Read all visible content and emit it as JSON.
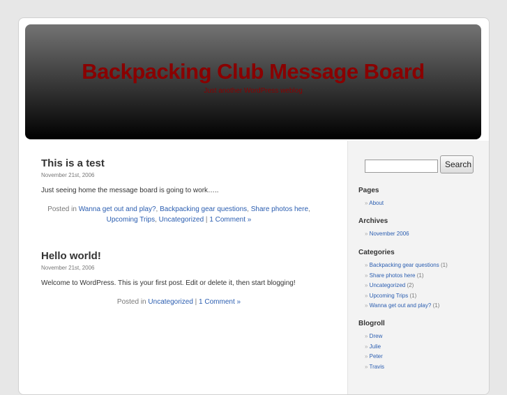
{
  "header": {
    "title": "Backpacking Club Message Board",
    "description": "Just another WordPress weblog"
  },
  "posts": [
    {
      "title": "This is a test",
      "date": "November 21st, 2006",
      "body": "Just seeing home the message board is going to work…..",
      "posted_in": "Posted in",
      "categories": [
        "Wanna get out and play?",
        "Backpacking gear questions",
        "Share photos here",
        "Upcoming Trips",
        "Uncategorized"
      ],
      "comments": "1 Comment »"
    },
    {
      "title": "Hello world!",
      "date": "November 21st, 2006",
      "body": "Welcome to WordPress. This is your first post. Edit or delete it, then start blogging!",
      "posted_in": "Posted in",
      "categories": [
        "Uncategorized"
      ],
      "comments": "1 Comment »"
    }
  ],
  "sidebar": {
    "search_button": "Search",
    "search_value": "",
    "pages": {
      "title": "Pages",
      "items": [
        "About"
      ]
    },
    "archives": {
      "title": "Archives",
      "items": [
        "November 2006"
      ]
    },
    "categories": {
      "title": "Categories",
      "items": [
        {
          "label": "Backpacking gear questions",
          "count": "(1)"
        },
        {
          "label": "Share photos here",
          "count": "(1)"
        },
        {
          "label": "Uncategorized",
          "count": "(2)"
        },
        {
          "label": "Upcoming Trips",
          "count": "(1)"
        },
        {
          "label": "Wanna get out and play?",
          "count": "(1)"
        }
      ]
    },
    "blogroll": {
      "title": "Blogroll",
      "items": [
        "Drew",
        "Julie",
        "Peter",
        "Travis"
      ]
    }
  }
}
